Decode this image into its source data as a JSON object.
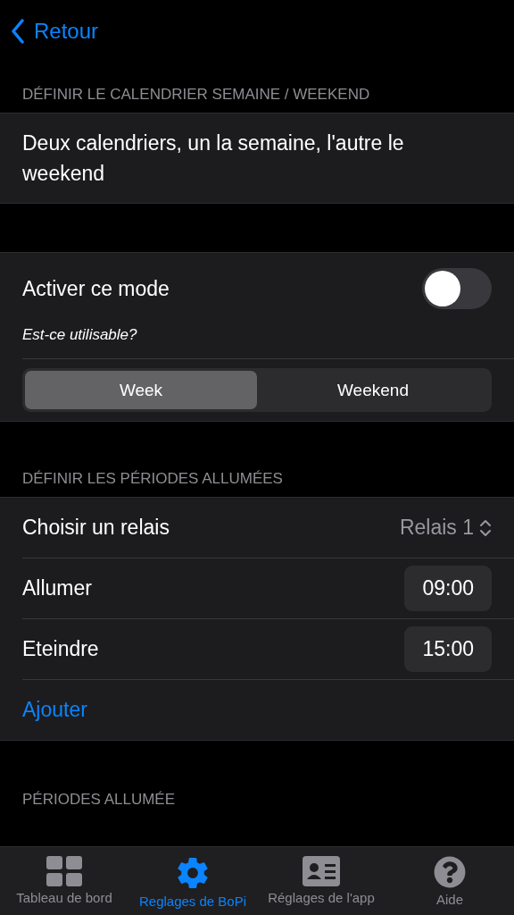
{
  "nav": {
    "back_label": "Retour"
  },
  "schedule_section": {
    "header": "DÉFINIR LE CALENDRIER SEMAINE / WEEKEND",
    "description": "Deux calendriers, un la semaine, l'autre le weekend"
  },
  "mode": {
    "label": "Activer ce mode",
    "on": false,
    "hint": "Est-ce utilisable?",
    "segments": [
      {
        "label": "Week",
        "selected": true
      },
      {
        "label": "Weekend",
        "selected": false
      }
    ]
  },
  "periods_section": {
    "header": "DÉFINIR LES PÉRIODES ALLUMÉES",
    "relay_label": "Choisir un relais",
    "relay_value": "Relais 1",
    "times": [
      {
        "label": "Allumer",
        "value": "09:00"
      },
      {
        "label": "Eteindre",
        "value": "15:00"
      }
    ],
    "add_label": "Ajouter"
  },
  "list_section": {
    "header": "PÉRIODES ALLUMÉE"
  },
  "tab_bar": [
    {
      "kind": "grid",
      "label": "Tableau de bord",
      "selected": false
    },
    {
      "kind": "gear",
      "label": "Reglages de BoPi",
      "selected": true
    },
    {
      "kind": "card",
      "label": "Réglages de l'app",
      "selected": false
    },
    {
      "kind": "help",
      "label": "Aide",
      "selected": false
    }
  ]
}
